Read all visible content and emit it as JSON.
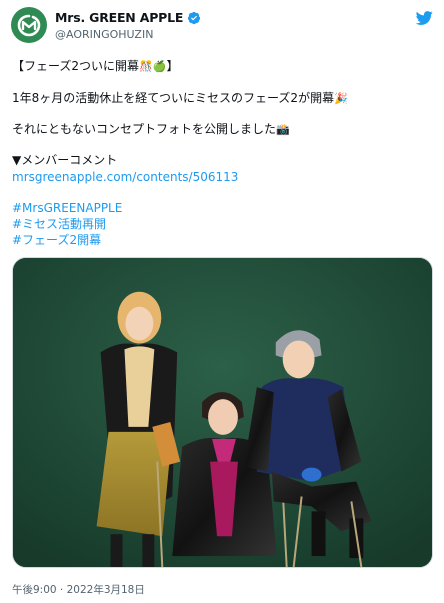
{
  "author": {
    "name": "Mrs. GREEN APPLE",
    "handle": "@AORINGOHUZIN",
    "verified": true,
    "avatar_icon": "green-apple-logo-icon",
    "avatar_color": "#2f8a53"
  },
  "tweet": {
    "line1": "【フェーズ2ついに開幕",
    "line1_emoji": "🎊🍏",
    "line1_end": "】",
    "line2": "1年8ヶ月の活動休止を経てついにミセスのフェーズ2が開幕",
    "line2_emoji": "🎉",
    "line3": "それにともないコンセプトフォトを公開しました",
    "line3_emoji": "📸",
    "line4": "▼メンバーコメント",
    "link": "mrsgreenapple.com/contents/506113",
    "hashtags": [
      "#MrsGREENAPPLE",
      "#ミセス活動再開",
      "#フェーズ2開幕"
    ]
  },
  "photo": {
    "description_icon": "band-concept-photo",
    "background_color": "#1f4a36"
  },
  "timestamp": "午後9:00 · 2022年3月18日",
  "colors": {
    "link": "#1d9bf0",
    "text": "#0f1419",
    "secondary": "#536471",
    "twitter_blue": "#1d9bf0"
  }
}
